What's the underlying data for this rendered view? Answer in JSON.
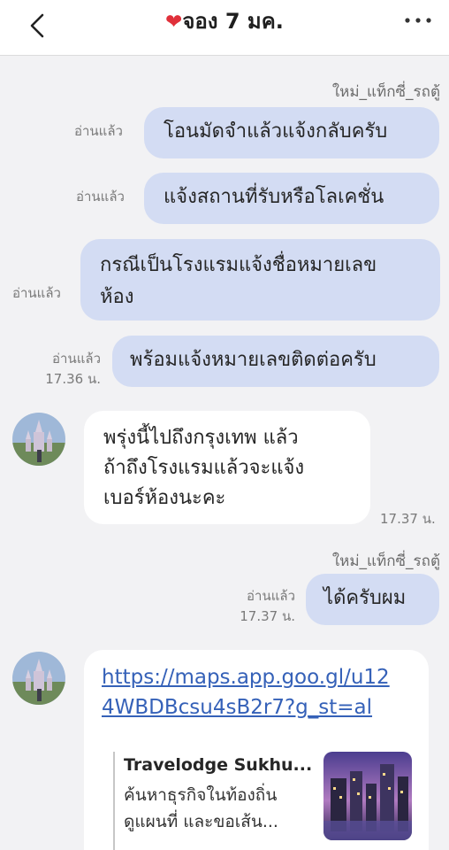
{
  "header": {
    "title": "จอง 7 มค.",
    "heart": "❤️"
  },
  "messages": {
    "sender_1": "ใหม่_แท็กซี่_รถตู้",
    "msg1": {
      "read": "อ่านแล้ว",
      "text": "โอนมัดจำแล้วแจ้งกลับครับ"
    },
    "msg2": {
      "read": "อ่านแล้ว",
      "text": "แจ้งสถานที่รับหรือโลเคชั่น"
    },
    "msg3": {
      "read": "อ่านแล้ว",
      "line1": "กรณีเป็นโรงแรมแจ้งชื่อหมายเลข",
      "line2": "ห้อง"
    },
    "msg4": {
      "read": "อ่านแล้ว",
      "time": "17.36 น.",
      "text": "พร้อมแจ้งหมายเลขติดต่อครับ"
    },
    "incoming1": {
      "line1": "พรุ่งนี้ไปถึงกรุงเทพ แล้ว",
      "line2": "ถ้าถึงโรงแรมแล้วจะแจ้ง",
      "line3": "เบอร์ห้องนะคะ",
      "time": "17.37 น."
    },
    "sender_2": "ใหม่_แท็กซี่_รถตู้",
    "msg5": {
      "read": "อ่านแล้ว",
      "time": "17.37 น.",
      "text": "ได้ครับผม"
    },
    "incoming2": {
      "link_line1": "https://maps.app.goo.gl/u12",
      "link_line2": "4WBDBcsu4sB2r7?g_st=al",
      "preview_title": "Travelodge Sukhu...",
      "preview_line1": "ค้นหาธุรกิจในท้องถิ่น",
      "preview_line2": "ดูแผนที่ และขอเส้น..."
    }
  },
  "colors": {
    "outgoing_bubble": "#d3dcf3",
    "incoming_bubble": "#ffffff",
    "background": "#f2f2f4",
    "link": "#3561b8",
    "heart": "#e0303a"
  },
  "icons": {
    "back": "chevron-left-icon",
    "more": "more-horizontal-icon",
    "avatar": "castle-avatar"
  }
}
